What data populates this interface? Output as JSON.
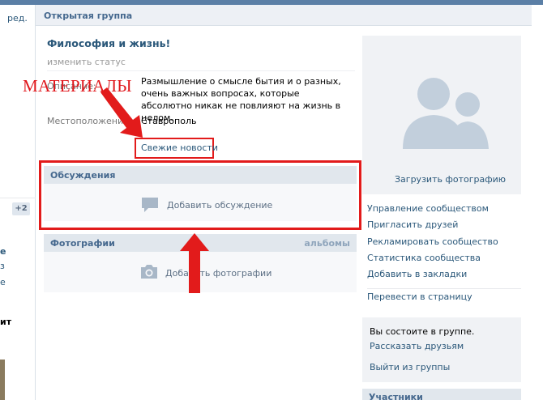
{
  "left": {
    "edit": "ред.",
    "badge": "+2",
    "frag1": "е",
    "frag2": "з",
    "frag3": "е",
    "frag4": "ит"
  },
  "header": {
    "title": "Открытая группа"
  },
  "group": {
    "name": "Философия и жизнь!",
    "status": "изменить статус",
    "description_label": "Описание:",
    "description": "Размышление о смысле бытия и о разных, очень важных вопросах, которые абсолютно никак не повлияют на жизнь в целом.",
    "location_label": "Местоположение:",
    "location": "Ставрополь",
    "news_link": "Свежие новости"
  },
  "annotation": {
    "text": "МАТЕРИАЛЫ"
  },
  "discussions": {
    "title": "Обсуждения",
    "add": "Добавить обсуждение"
  },
  "photos": {
    "title": "Фотографии",
    "albums": "альбомы",
    "add": "Добавить фотографии"
  },
  "cover": {
    "upload": "Загрузить фотографию"
  },
  "menu": {
    "items": [
      "Управление сообществом",
      "Пригласить друзей",
      "Рекламировать сообщество",
      "Статистика сообщества",
      "Добавить в закладки"
    ],
    "convert": "Перевести в страницу"
  },
  "membership": {
    "status": "Вы состоите в группе.",
    "tell": "Рассказать друзьям",
    "leave": "Выйти из группы"
  },
  "participants": {
    "title": "Участники"
  },
  "colors": {
    "accent": "#2b587a",
    "annotation": "#e21b1b",
    "header_bg": "#edf0f5"
  }
}
